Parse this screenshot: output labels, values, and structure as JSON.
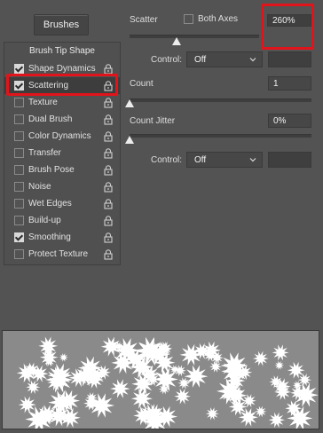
{
  "brushes_button": "Brushes",
  "brush_tip_shape": "Brush Tip Shape",
  "options": [
    {
      "label": "Shape Dynamics",
      "checked": true,
      "locked": true
    },
    {
      "label": "Scattering",
      "checked": true,
      "locked": true,
      "selected": true
    },
    {
      "label": "Texture",
      "checked": false,
      "locked": true
    },
    {
      "label": "Dual Brush",
      "checked": false,
      "locked": true
    },
    {
      "label": "Color Dynamics",
      "checked": false,
      "locked": true
    },
    {
      "label": "Transfer",
      "checked": false,
      "locked": true
    },
    {
      "label": "Brush Pose",
      "checked": false,
      "locked": true
    },
    {
      "label": "Noise",
      "checked": false,
      "locked": true
    },
    {
      "label": "Wet Edges",
      "checked": false,
      "locked": true
    },
    {
      "label": "Build-up",
      "checked": false,
      "locked": true
    },
    {
      "label": "Smoothing",
      "checked": true,
      "locked": true
    },
    {
      "label": "Protect Texture",
      "checked": false,
      "locked": true
    }
  ],
  "scatter": {
    "label": "Scatter",
    "both_axes_label": "Both Axes",
    "both_axes_checked": false,
    "value": "260%",
    "control_label": "Control:",
    "control_value": "Off"
  },
  "count": {
    "label": "Count",
    "value": "1"
  },
  "count_jitter": {
    "label": "Count Jitter",
    "value": "0%",
    "control_label": "Control:",
    "control_value": "Off"
  },
  "colors": {
    "highlight": "#e2141b",
    "panel_bg": "#535353"
  }
}
